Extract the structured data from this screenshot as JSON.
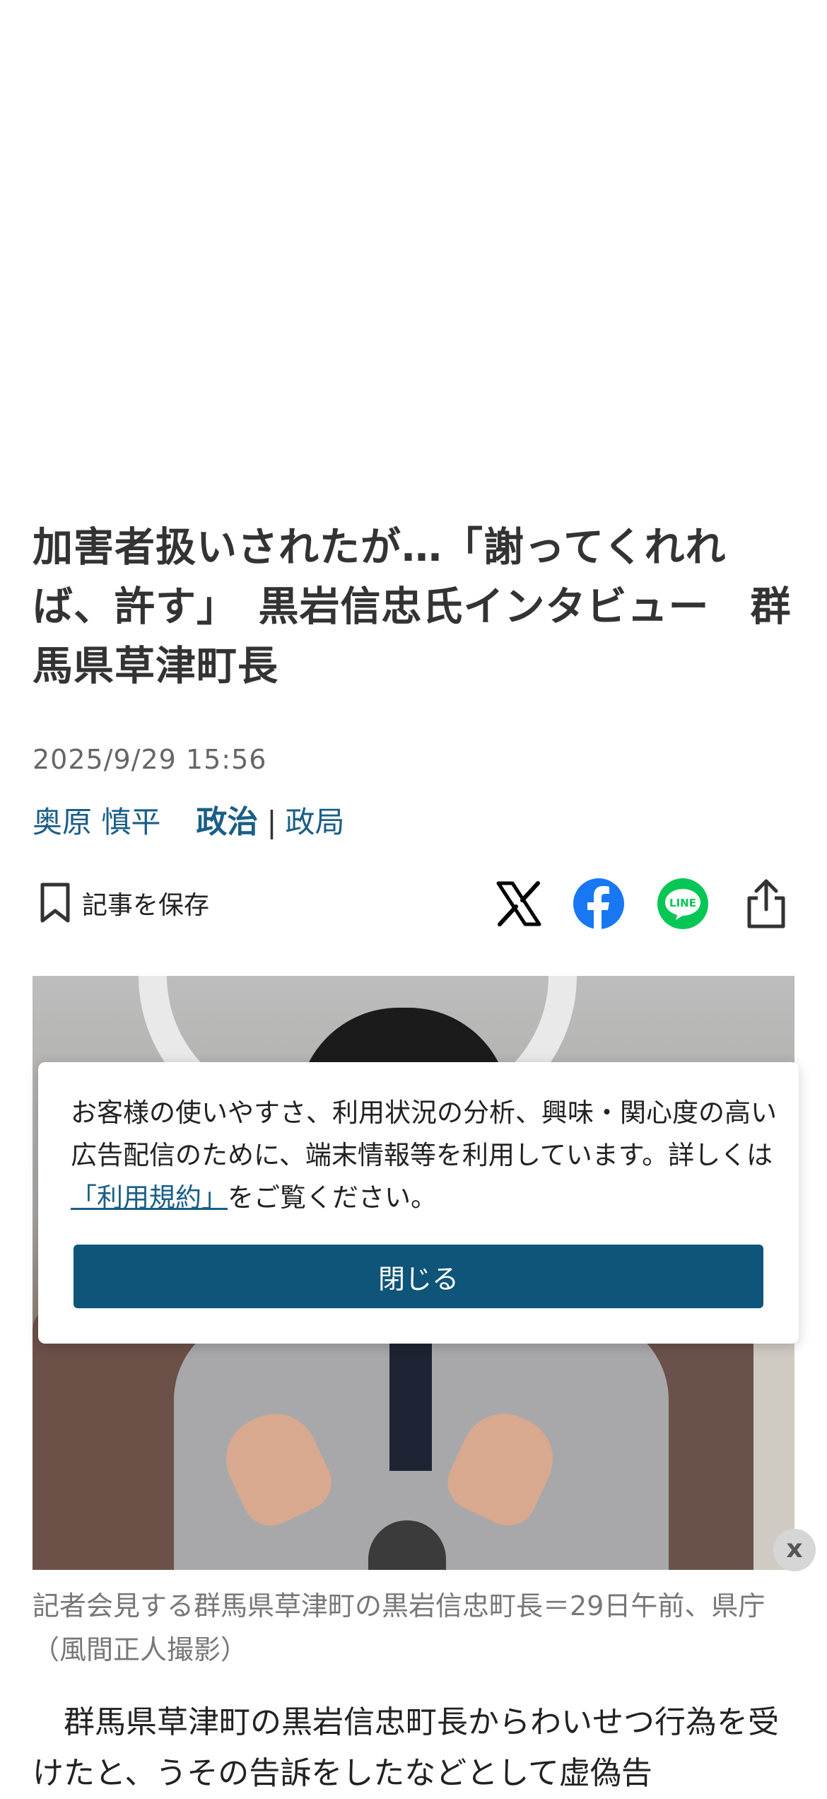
{
  "article": {
    "headline": "加害者扱いされたが…「謝ってくれれば、許す」　黒岩信忠氏インタビュー　群馬県草津町長",
    "timestamp": "2025/9/29 15:56",
    "author": "奥原 慎平",
    "category": "政治",
    "category_separator": "|",
    "subcategory": "政局"
  },
  "actions": {
    "save_label": "記事を保存",
    "share_icons": [
      "x-icon",
      "facebook-icon",
      "line-icon",
      "share-icon"
    ],
    "line_text": "LINE"
  },
  "photo": {
    "close_label": "x",
    "caption": "記者会見する群馬県草津町の黒岩信忠町長＝29日午前、県庁（風間正人撮影）"
  },
  "body": {
    "paragraph": "群馬県草津町の黒岩信忠町長からわいせつ行為を受けたと、うその告訴をしたなどとして虚偽告"
  },
  "consent": {
    "text_before": "お客様の使いやすさ、利用状況の分析、興味・関心度の高い広告配信のために、端末情報等を利用しています。詳しくは",
    "link_text": "「利用規約」",
    "text_after": "をご覧ください。",
    "close_label": "閉じる"
  },
  "colors": {
    "accent": "#1a5e86",
    "button": "#0f5479",
    "facebook": "#1877f2",
    "line": "#06c755"
  }
}
